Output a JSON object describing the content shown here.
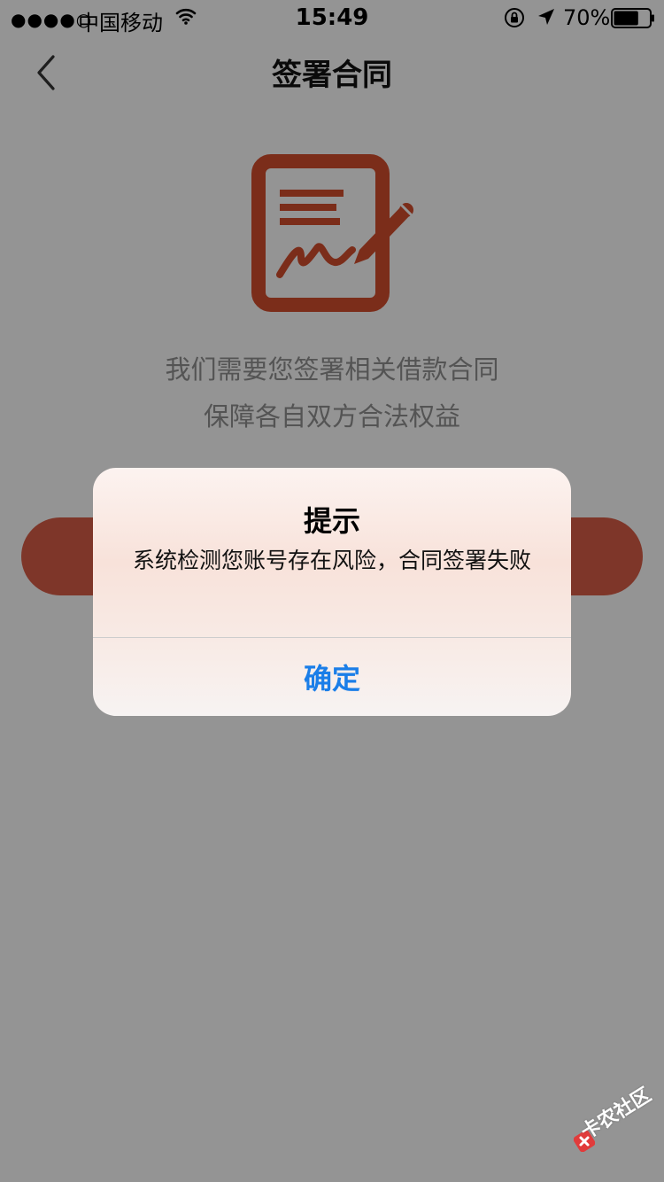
{
  "status_bar": {
    "signal": "●●●●○",
    "carrier": "中国移动",
    "time": "15:49",
    "battery_percent": "70%",
    "battery_level": 0.7,
    "icons": [
      "wifi-icon",
      "orientation-lock-icon",
      "location-arrow-icon",
      "battery-icon"
    ]
  },
  "nav": {
    "back_icon": "chevron-left-icon",
    "title": "签署合同"
  },
  "page": {
    "icon": "contract-sign-icon",
    "description_lines": [
      "我们需要您签署相关借款合同",
      "保障各自双方合法权益"
    ]
  },
  "alert": {
    "title": "提示",
    "message": "系统检测您账号存在风险，合同签署失败",
    "confirm_label": "确定"
  },
  "watermark": {
    "text": "卡农社区",
    "icon": "kanong-logo-icon"
  },
  "colors": {
    "accent_red": "#d25a45",
    "icon_red": "#cd4b2c",
    "alert_button_blue": "#1a7ee8",
    "overlay": "rgba(0,0,0,0.4)"
  }
}
